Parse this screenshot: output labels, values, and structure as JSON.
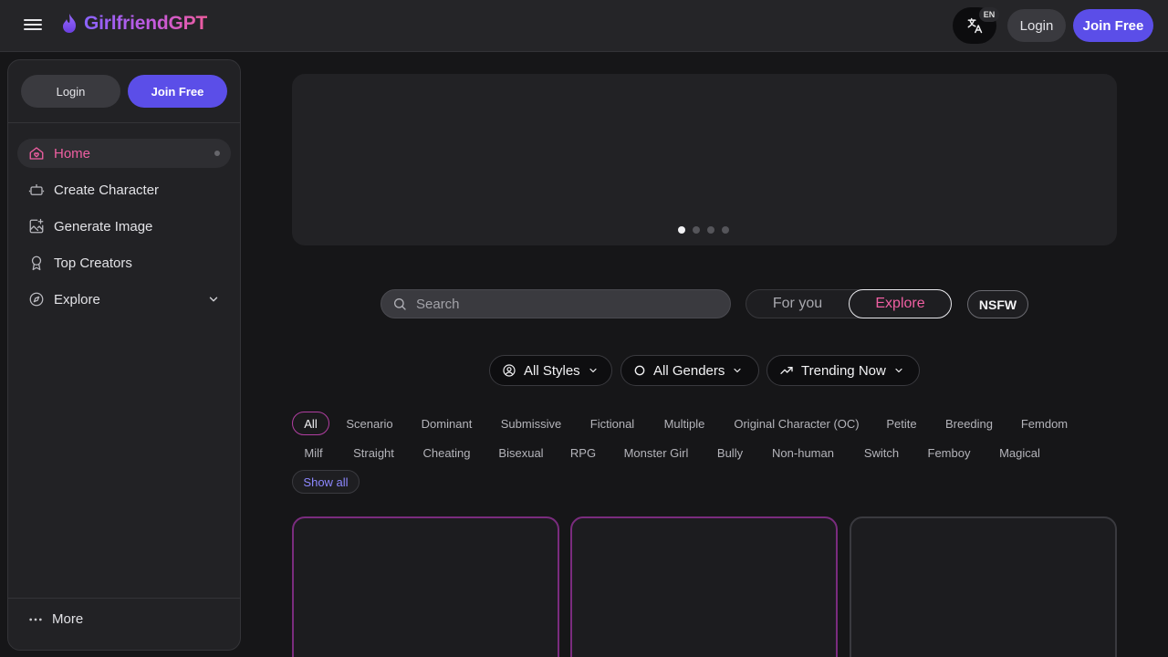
{
  "header": {
    "brand": "GirlfriendGPT",
    "lang_badge": "EN",
    "login_label": "Login",
    "join_label": "Join Free"
  },
  "sidebar": {
    "login_label": "Login",
    "join_label": "Join Free",
    "items": [
      {
        "label": "Home",
        "icon": "home-icon",
        "active": true
      },
      {
        "label": "Create Character",
        "icon": "robot-icon"
      },
      {
        "label": "Generate Image",
        "icon": "image-plus-icon"
      },
      {
        "label": "Top Creators",
        "icon": "award-icon"
      },
      {
        "label": "Explore",
        "icon": "compass-icon"
      }
    ],
    "more_label": "More"
  },
  "banner": {
    "slides": 4,
    "active_slide": 1
  },
  "search": {
    "placeholder": "Search"
  },
  "feed_toggle": {
    "for_you": "For you",
    "explore": "Explore",
    "selected": "Explore"
  },
  "nsfw_label": "NSFW",
  "filters": {
    "styles": "All Styles",
    "genders": "All Genders",
    "sort": "Trending Now"
  },
  "tags": {
    "row1": [
      "All",
      "Scenario",
      "Dominant",
      "Submissive",
      "Fictional",
      "Multiple",
      "Original Character (OC)",
      "Petite",
      "Breeding",
      "Femdom"
    ],
    "row2": [
      "Milf",
      "Straight",
      "Cheating",
      "Bisexual",
      "RPG",
      "Monster Girl",
      "Bully",
      "Non-human",
      "Switch",
      "Femboy",
      "Magical"
    ],
    "show_all": "Show all",
    "selected": "All"
  },
  "colors": {
    "accent_pink": "#ef5fa2",
    "accent_purple": "#5b4ee8",
    "background": "#161618"
  }
}
